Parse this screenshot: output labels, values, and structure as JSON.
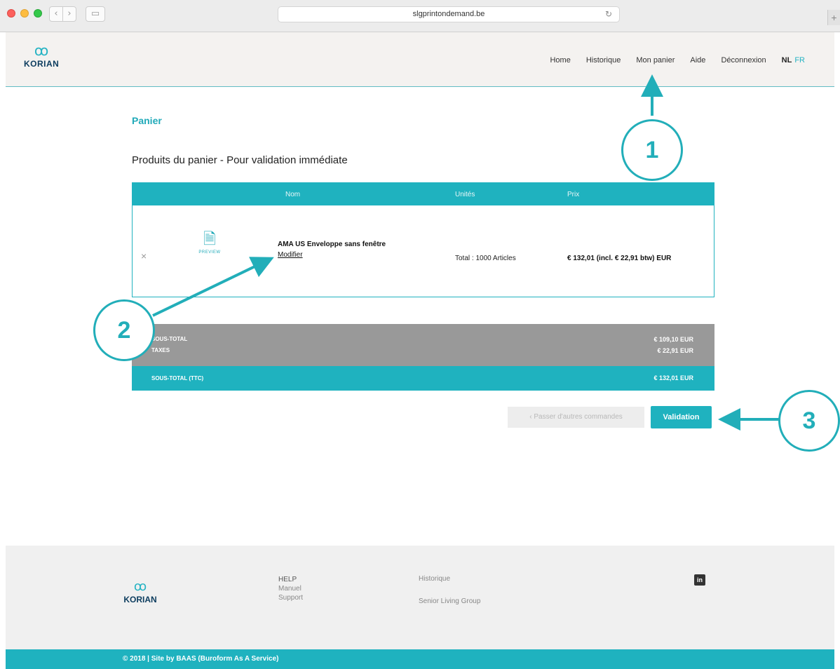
{
  "browser": {
    "url": "slgprintondemand.be",
    "back_glyph": "‹",
    "forward_glyph": "›",
    "sidebar_glyph": "▭",
    "reload_glyph": "↻",
    "plus_glyph": "+"
  },
  "header": {
    "logo_text": "KORIAN",
    "logo_mark": "ꝏ",
    "nav": {
      "home": "Home",
      "historique": "Historique",
      "mon_panier": "Mon panier",
      "aide": "Aide",
      "deconnexion": "Déconnexion",
      "lang_nl": "NL",
      "lang_fr": "FR"
    }
  },
  "main": {
    "title": "Panier",
    "section_title": "Produits du panier - Pour validation immédiate",
    "table": {
      "columns": {
        "nom": "Nom",
        "unites": "Unités",
        "prix": "Prix"
      },
      "rows": [
        {
          "remove": "×",
          "preview_icon": "🗎",
          "preview_label": "PREVIEW",
          "name": "AMA US Enveloppe sans fenêtre",
          "modify": "Modifier",
          "units": "Total : 1000 Articles",
          "price": "€ 132,01 (incl. € 22,91 btw) EUR"
        }
      ]
    },
    "totals": {
      "subtotal_label": "SOUS-TOTAL",
      "subtotal_value": "€ 109,10 EUR",
      "taxes_label": "TAXES",
      "taxes_value": "€ 22,91 EUR",
      "total_label": "SOUS-TOTAL (TTC)",
      "total_value": "€ 132,01 EUR"
    },
    "buttons": {
      "other_orders": "‹ Passer d'autres commandes",
      "validation": "Validation"
    }
  },
  "annotations": {
    "one": "1",
    "two": "2",
    "three": "3",
    "color": "#22aeb9"
  },
  "footer": {
    "logo_text": "KORIAN",
    "help": "HELP",
    "manuel": "Manuel",
    "support": "Support",
    "historique": "Historique",
    "senior": "Senior Living Group",
    "linkedin": "in",
    "copyright": "© 2018 | Site by BAAS (Buroform As A Service)"
  }
}
